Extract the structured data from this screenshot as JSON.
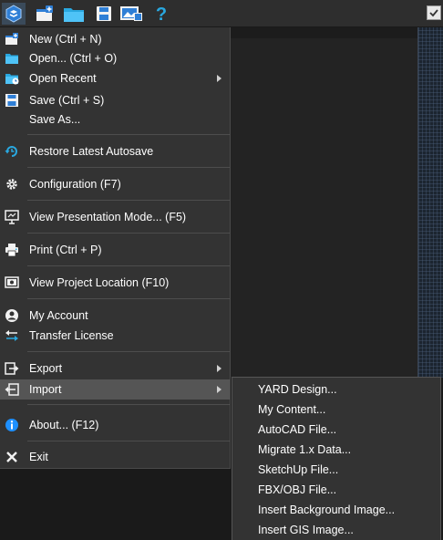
{
  "toolbar": {
    "buttons": [
      {
        "icon": "app-logo-icon"
      },
      {
        "icon": "new-project-icon"
      },
      {
        "icon": "open-folder-icon"
      },
      {
        "icon": "save-disk-icon"
      },
      {
        "icon": "presentation-image-icon"
      },
      {
        "icon": "help-icon"
      }
    ],
    "checkbox_icon": "checkbox-checked-icon"
  },
  "menu": {
    "items": [
      {
        "label": "New (Ctrl + N)",
        "icon": "new-icon"
      },
      {
        "label": "Open... (Ctrl + O)",
        "icon": "folder-icon"
      },
      {
        "label": "Open Recent",
        "icon": "recent-icon",
        "submenu": true
      },
      {
        "label": "Save (Ctrl + S)",
        "icon": "save-icon"
      },
      {
        "label": "Save As...",
        "icon": ""
      },
      {
        "label": "Restore Latest Autosave",
        "icon": "restore-icon"
      },
      {
        "label": "Configuration (F7)",
        "icon": "gear-icon"
      },
      {
        "label": "View Presentation Mode... (F5)",
        "icon": "presentation-icon"
      },
      {
        "label": "Print (Ctrl + P)",
        "icon": "printer-icon"
      },
      {
        "label": "View Project Location (F10)",
        "icon": "location-icon"
      },
      {
        "label": "My Account",
        "icon": "account-icon"
      },
      {
        "label": "Transfer License",
        "icon": "transfer-icon"
      },
      {
        "label": "Export",
        "icon": "export-icon",
        "submenu": true
      },
      {
        "label": "Import",
        "icon": "import-icon",
        "submenu": true,
        "highlighted": true
      },
      {
        "label": "About... (F12)",
        "icon": "info-icon"
      },
      {
        "label": "Exit",
        "icon": "close-icon"
      }
    ]
  },
  "import_submenu": {
    "items": [
      "YARD Design...",
      "My Content...",
      "AutoCAD File...",
      "Migrate 1.x Data...",
      "SketchUp File...",
      "FBX/OBJ File...",
      "Insert Background Image...",
      "Insert GIS Image..."
    ]
  },
  "colors": {
    "menu_bg": "#333333",
    "highlight_bg": "#555555",
    "accent_blue": "#1e90ff",
    "text": "#ffffff"
  }
}
